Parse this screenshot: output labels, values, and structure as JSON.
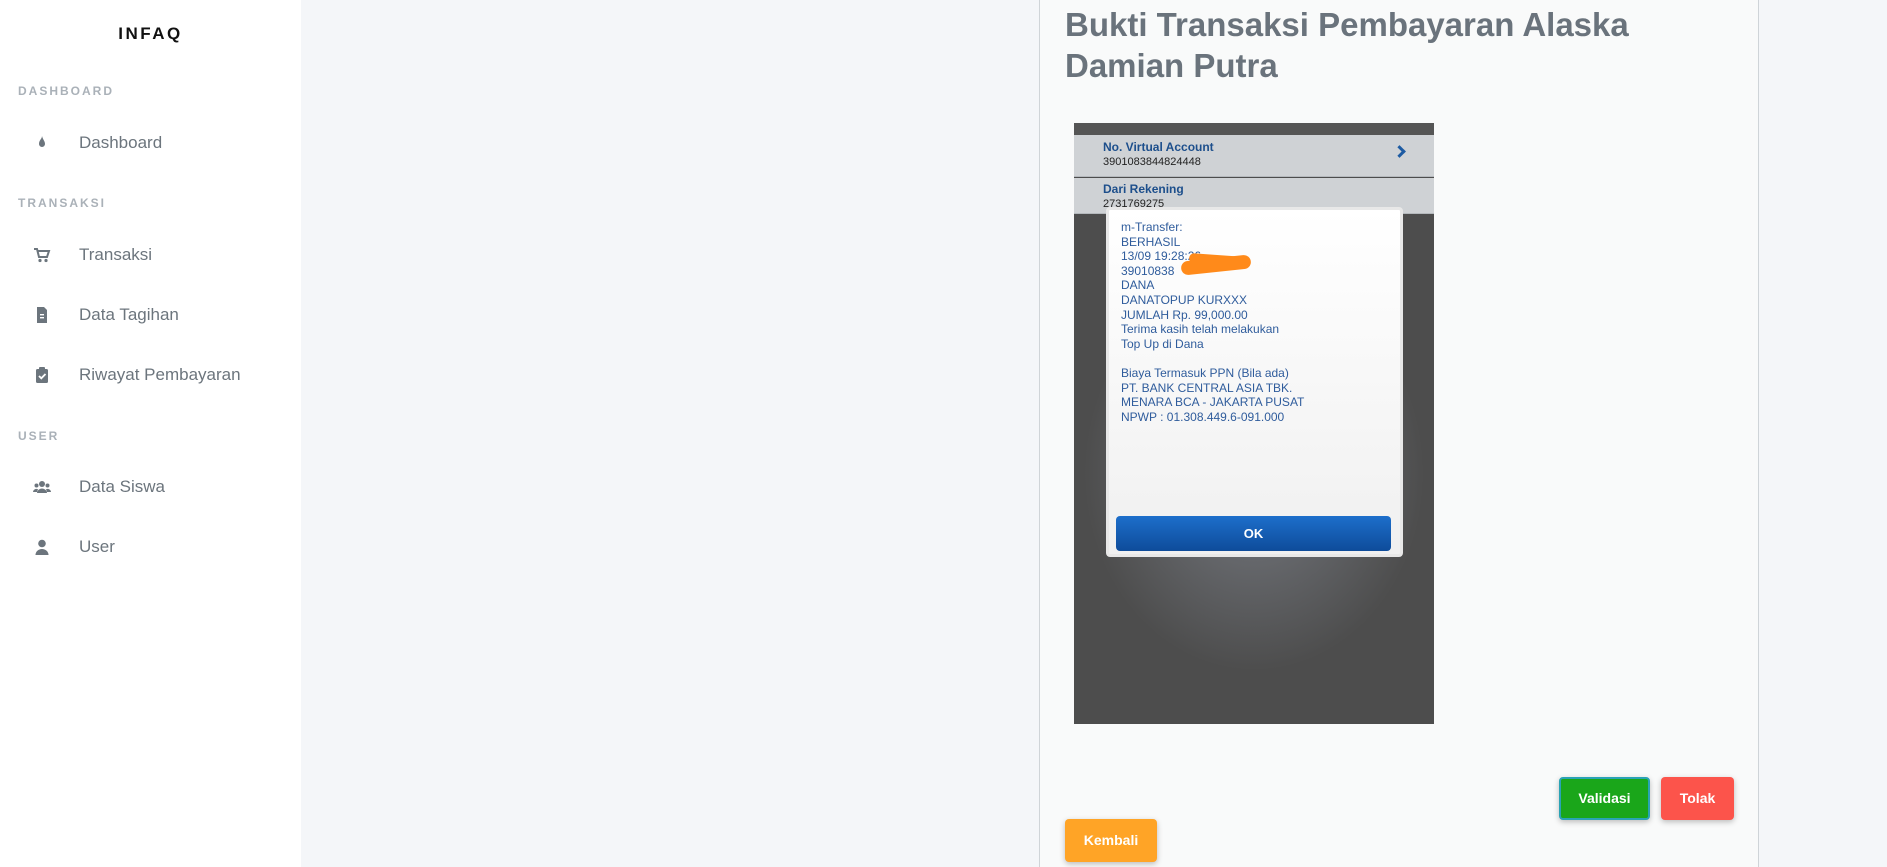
{
  "sidebar": {
    "brand": "INFAQ",
    "sections": [
      {
        "label": "DASHBOARD"
      },
      {
        "label": "TRANSAKSI"
      },
      {
        "label": "USER"
      }
    ],
    "items": [
      {
        "label": "Dashboard",
        "icon": "fire-icon"
      },
      {
        "label": "Transaksi",
        "icon": "cart-icon"
      },
      {
        "label": "Data Tagihan",
        "icon": "invoice-icon"
      },
      {
        "label": "Riwayat Pembayaran",
        "icon": "clipboard-check-icon"
      },
      {
        "label": "Data Siswa",
        "icon": "users-icon"
      },
      {
        "label": "User",
        "icon": "user-icon"
      }
    ]
  },
  "main": {
    "title": "Bukti Transaksi Pembayaran Alaska Damian Putra",
    "receipt": {
      "row1_label": "No. Virtual Account",
      "row1_value": "3901083844824448",
      "row2_label": "Dari Rekening",
      "row2_value": "2731769275",
      "dialog_text": "m-Transfer:\nBERHASIL\n13/09 19:28:26\n39010838\nDANA\nDANATOPUP KURXXX\nJUMLAH Rp. 99,000.00\nTerima kasih telah melakukan\nTop Up di Dana\n\nBiaya Termasuk PPN (Bila ada)\nPT. BANK CENTRAL ASIA TBK.\nMENARA BCA - JAKARTA PUSAT\nNPWP : 01.308.449.6-091.000",
      "ok_label": "OK"
    },
    "buttons": {
      "validasi": "Validasi",
      "tolak": "Tolak",
      "kembali": "Kembali"
    }
  },
  "colors": {
    "validasi": "#1aa61a",
    "tolak": "#fc544b",
    "kembali": "#ffa426",
    "title": "#6a737c"
  }
}
